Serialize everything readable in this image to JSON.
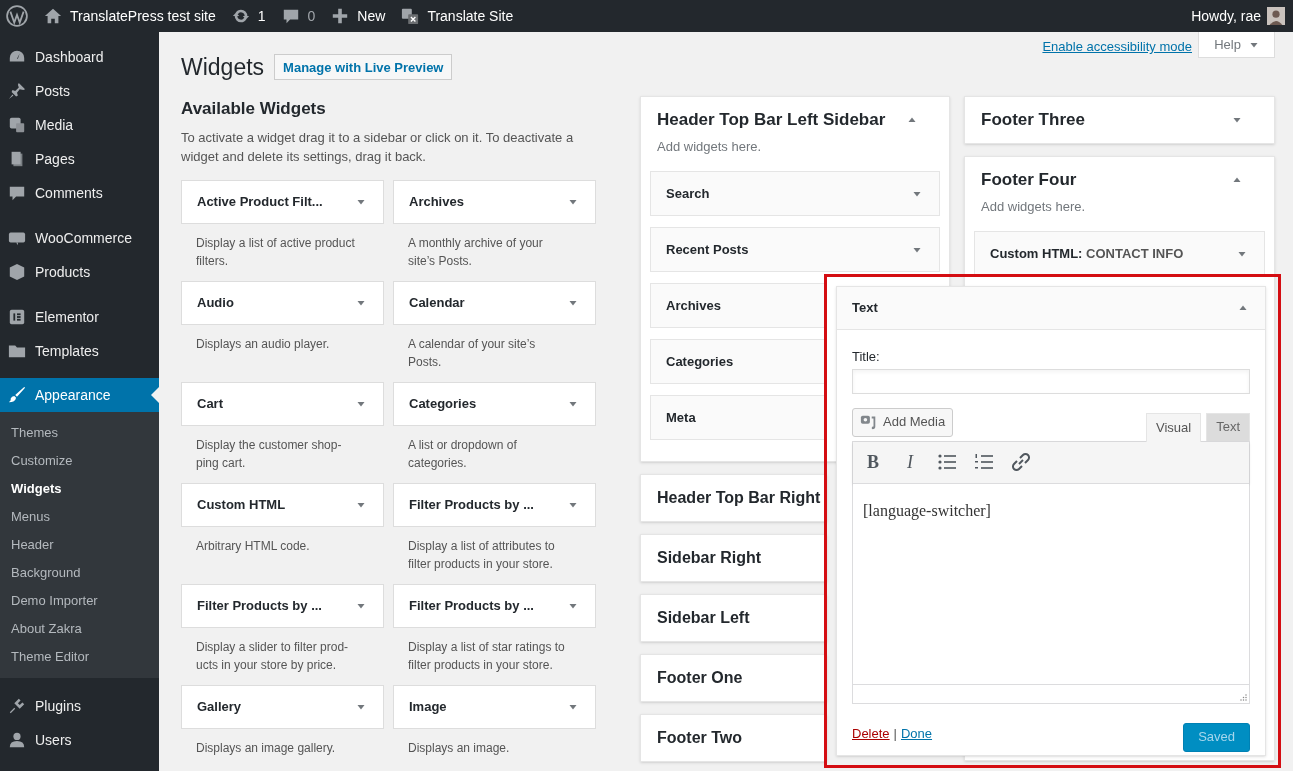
{
  "admin_bar": {
    "items": [
      {
        "kind": "wp"
      },
      {
        "kind": "home",
        "label": "TranslatePress test site"
      },
      {
        "kind": "updates",
        "label": "1"
      },
      {
        "kind": "comments",
        "label": "0"
      },
      {
        "kind": "new",
        "label": "New"
      },
      {
        "kind": "translate",
        "label": "Translate Site"
      }
    ],
    "greeting": "Howdy, rae"
  },
  "sidebar": {
    "items": [
      {
        "kind": "dashboard",
        "label": "Dashboard",
        "selected": false
      },
      {
        "kind": "pin",
        "label": "Posts",
        "selected": false
      },
      {
        "kind": "media",
        "label": "Media",
        "selected": false
      },
      {
        "kind": "page",
        "label": "Pages",
        "selected": false
      },
      {
        "kind": "comment",
        "label": "Comments",
        "selected": false
      },
      {
        "kind": "woo",
        "label": "WooCommerce",
        "selected": false
      },
      {
        "kind": "box",
        "label": "Products",
        "selected": false
      },
      {
        "kind": "elementor",
        "label": "Elementor",
        "selected": false
      },
      {
        "kind": "folder",
        "label": "Templates",
        "selected": false
      },
      {
        "kind": "brush",
        "label": "Appearance",
        "selected": true,
        "children": [
          {
            "label": "Themes",
            "selected": false
          },
          {
            "label": "Customize",
            "selected": false
          },
          {
            "label": "Widgets",
            "selected": true
          },
          {
            "label": "Menus",
            "selected": false
          },
          {
            "label": "Header",
            "selected": false
          },
          {
            "label": "Background",
            "selected": false
          },
          {
            "label": "Demo Importer",
            "selected": false
          },
          {
            "label": "About Zakra",
            "selected": false
          },
          {
            "label": "Theme Editor",
            "selected": false
          }
        ]
      },
      {
        "kind": "plug",
        "label": "Plugins",
        "selected": false
      },
      {
        "kind": "user",
        "label": "Users",
        "selected": false
      }
    ]
  },
  "header": {
    "title": "Widgets",
    "live_preview": "Manage with Live Preview",
    "accessibility_link": "Enable accessibility mode",
    "help": "Help"
  },
  "available": {
    "title": "Available Widgets",
    "intro": "To activate a widget drag it to a sidebar or click on it. To deactivate a widget and delete its settings, drag it back.",
    "widgets": [
      {
        "name": "Active Product Filt...",
        "description": "Display a list of active product\nfilters."
      },
      {
        "name": "Archives",
        "description": "A monthly archive of your\nsite’s Posts."
      },
      {
        "name": "Audio",
        "description": "Displays an audio player."
      },
      {
        "name": "Calendar",
        "description": "A calendar of your site’s\nPosts."
      },
      {
        "name": "Cart",
        "description": "Display the customer shop-\nping cart."
      },
      {
        "name": "Categories",
        "description": "A list or dropdown of\ncategories."
      },
      {
        "name": "Custom HTML",
        "description": "Arbitrary HTML code."
      },
      {
        "name": "Filter Products by ...",
        "description": "Display a list of attributes to\nfilter products in your store."
      },
      {
        "name": "Filter Products by ...",
        "description": "Display a slider to filter prod-\nucts in your store by price."
      },
      {
        "name": "Filter Products by ...",
        "description": "Display a list of star ratings to\nfilter products in your store."
      },
      {
        "name": "Gallery",
        "description": "Displays an image gallery."
      },
      {
        "name": "Image",
        "description": "Displays an image."
      }
    ]
  },
  "middle_column": [
    {
      "title": "Header Top Bar Left Sidebar",
      "expanded": true,
      "description": "Add widgets here.",
      "widgets": [
        {
          "name": "Search",
          "arrow": true
        },
        {
          "name": "Recent Posts",
          "arrow": true
        },
        {
          "name": "Archives",
          "arrow": false
        },
        {
          "name": "Categories",
          "arrow": false
        },
        {
          "name": "Meta",
          "arrow": false
        }
      ]
    },
    {
      "title": "Header Top Bar Right"
    },
    {
      "title": "Sidebar Right"
    },
    {
      "title": "Sidebar Left"
    },
    {
      "title": "Footer One"
    },
    {
      "title": "Footer Two"
    }
  ],
  "right_column": [
    {
      "title": "Footer Three",
      "expanded": false
    },
    {
      "title": "Footer Four",
      "expanded": true,
      "description": "Add widgets here.",
      "widgets": [
        {
          "name": "Custom HTML:",
          "suffix": "CONTACT INFO"
        }
      ]
    }
  ],
  "text_widget": {
    "title": "Text",
    "expanded": true,
    "title_label": "Title:",
    "add_media": "Add Media",
    "tabs": [
      {
        "label": "Visual",
        "selected": true
      },
      {
        "label": "Text",
        "selected": false
      }
    ],
    "toolbar": [
      {
        "kind": "bold",
        "label": "B"
      },
      {
        "kind": "italic",
        "label": "I"
      },
      {
        "kind": "bullets"
      },
      {
        "kind": "numbers"
      },
      {
        "kind": "link"
      }
    ],
    "content": "[language-switcher]",
    "delete": "Delete",
    "separator": "|",
    "done": "Done",
    "save": {
      "label": "Saved",
      "disabled": true
    }
  }
}
